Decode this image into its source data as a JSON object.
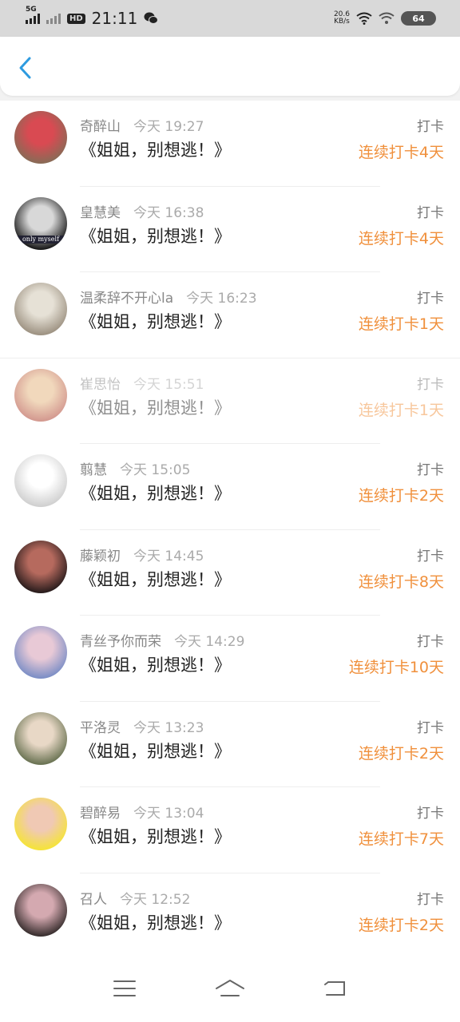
{
  "status": {
    "network": "5G",
    "hd": "HD",
    "time": "21:11",
    "speed_value": "20.6",
    "speed_unit": "KB/s",
    "battery": "64",
    "icons": [
      "signal-icon",
      "signal-icon",
      "wechat-icon",
      "wifi-icon",
      "wifi-icon",
      "battery-icon"
    ]
  },
  "header": {
    "back_icon": "chevron-left-icon",
    "accent": "#2e9be0"
  },
  "list": [
    {
      "name": "奇醉山",
      "time": "今天 19:27",
      "title": "《姐姐，别想逃！》",
      "kind": "打卡",
      "streak": "连续打卡4天",
      "avatar_colors": [
        "#8a6a56",
        "#d94a52"
      ]
    },
    {
      "name": "皇慧美",
      "time": "今天 16:38",
      "title": "《姐姐，别想逃！》",
      "kind": "打卡",
      "streak": "连续打卡4天",
      "avatar_colors": [
        "#1a1a1a",
        "#d8d8d8"
      ],
      "avatar_text": "only myself"
    },
    {
      "name": "温柔辞不开心la",
      "time": "今天 16:23",
      "title": "《姐姐，别想逃！》",
      "kind": "打卡",
      "streak": "连续打卡1天",
      "avatar_colors": [
        "#9e9383",
        "#e6e1d6"
      ]
    },
    {
      "name": "崔思怡",
      "time": "今天 15:51",
      "title": "《姐姐，别想逃！》",
      "kind": "打卡",
      "streak": "连续打卡1天",
      "avatar_colors": [
        "#a83421",
        "#e3b27a"
      ],
      "faded": true
    },
    {
      "name": "翦慧",
      "time": "今天 15:05",
      "title": "《姐姐，别想逃！》",
      "kind": "打卡",
      "streak": "连续打卡2天",
      "avatar_colors": [
        "#d0d0d0",
        "#ffffff"
      ]
    },
    {
      "name": "藤颖初",
      "time": "今天 14:45",
      "title": "《姐姐，别想逃！》",
      "kind": "打卡",
      "streak": "连续打卡8天",
      "avatar_colors": [
        "#2a1d1d",
        "#b66a5e"
      ]
    },
    {
      "name": "青丝予你而荣",
      "time": "今天 14:29",
      "title": "《姐姐，别想逃！》",
      "kind": "打卡",
      "streak": "连续打卡10天",
      "avatar_colors": [
        "#7d8fc6",
        "#e8c9d6"
      ]
    },
    {
      "name": "平洛灵",
      "time": "今天 13:23",
      "title": "《姐姐，别想逃！》",
      "kind": "打卡",
      "streak": "连续打卡2天",
      "avatar_colors": [
        "#6b7454",
        "#e8d8c6"
      ]
    },
    {
      "name": "碧醉易",
      "time": "今天 13:04",
      "title": "《姐姐，别想逃！》",
      "kind": "打卡",
      "streak": "连续打卡7天",
      "avatar_colors": [
        "#f5e33a",
        "#f0c9b4"
      ]
    },
    {
      "name": "召人",
      "time": "今天 12:52",
      "title": "《姐姐，别想逃！》",
      "kind": "打卡",
      "streak": "连续打卡2天",
      "avatar_colors": [
        "#3a3030",
        "#d4a9b0"
      ]
    }
  ],
  "navbar": {
    "icons": [
      "menu-icon",
      "home-icon",
      "back-icon"
    ]
  }
}
